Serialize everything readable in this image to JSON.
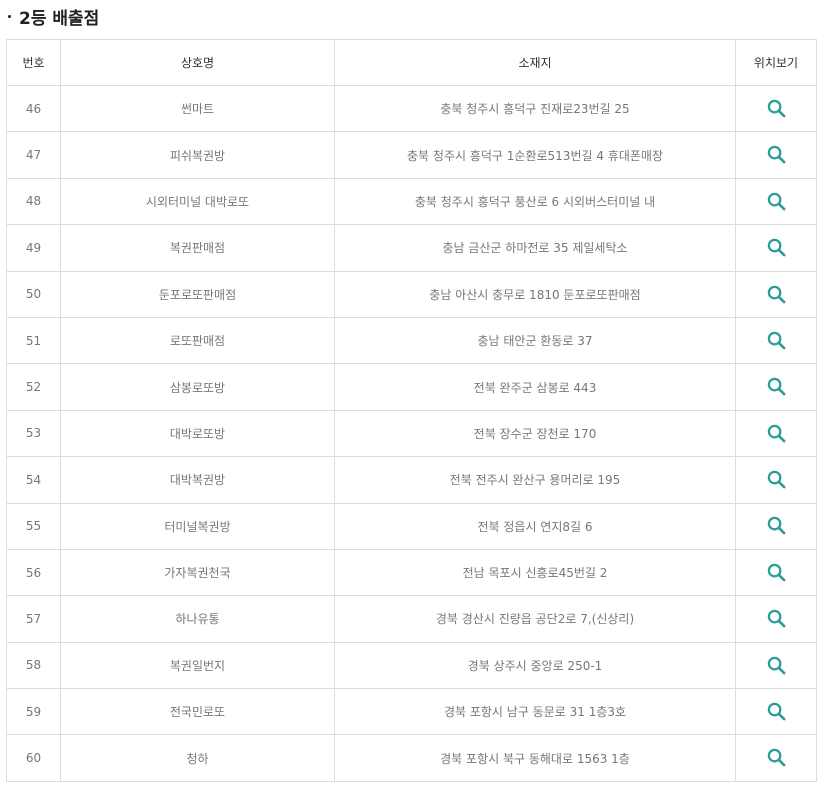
{
  "section": {
    "title": "2등 배출점"
  },
  "table": {
    "headers": [
      "번호",
      "상호명",
      "소재지",
      "위치보기"
    ],
    "rows": [
      {
        "no": "46",
        "name": "썬마트",
        "address": "충북 청주시 흥덕구 진재로23번길 25"
      },
      {
        "no": "47",
        "name": "피쉬복권방",
        "address": "충북 청주시 흥덕구 1순환로513번길 4 휴대폰매장"
      },
      {
        "no": "48",
        "name": "시외터미널 대박로또",
        "address": "충북 청주시 흥덕구 풍산로 6 시외버스터미널 내"
      },
      {
        "no": "49",
        "name": "복권판매점",
        "address": "충남 금산군 하마전로 35 제일세탁소"
      },
      {
        "no": "50",
        "name": "둔포로또판매점",
        "address": "충남 아산시 충무로 1810 둔포로또판매점"
      },
      {
        "no": "51",
        "name": "로또판매점",
        "address": "충남 태안군 환동로 37"
      },
      {
        "no": "52",
        "name": "삼봉로또방",
        "address": "전북 완주군 삼봉로 443"
      },
      {
        "no": "53",
        "name": "대박로또방",
        "address": "전북 장수군 장천로 170"
      },
      {
        "no": "54",
        "name": "대박복권방",
        "address": "전북 전주시 완산구 용머리로 195"
      },
      {
        "no": "55",
        "name": "터미널복권방",
        "address": "전북 정읍시 연지8길 6"
      },
      {
        "no": "56",
        "name": "가자복권천국",
        "address": "전남 목포시 신흥로45번길 2"
      },
      {
        "no": "57",
        "name": "하나유통",
        "address": "경북 경산시 진량읍 공단2로 7,(신상리)"
      },
      {
        "no": "58",
        "name": "복권일번지",
        "address": "경북 상주시 중앙로 250-1"
      },
      {
        "no": "59",
        "name": "전국민로또",
        "address": "경북 포항시 남구 동문로 31 1층3호"
      },
      {
        "no": "60",
        "name": "청하",
        "address": "경북 포항시 북구 동해대로 1563 1층"
      }
    ],
    "view_icon": "search-icon"
  },
  "colors": {
    "icon": "#2a9d9a",
    "header_border": "#333333",
    "cell_border": "#dddddd"
  }
}
